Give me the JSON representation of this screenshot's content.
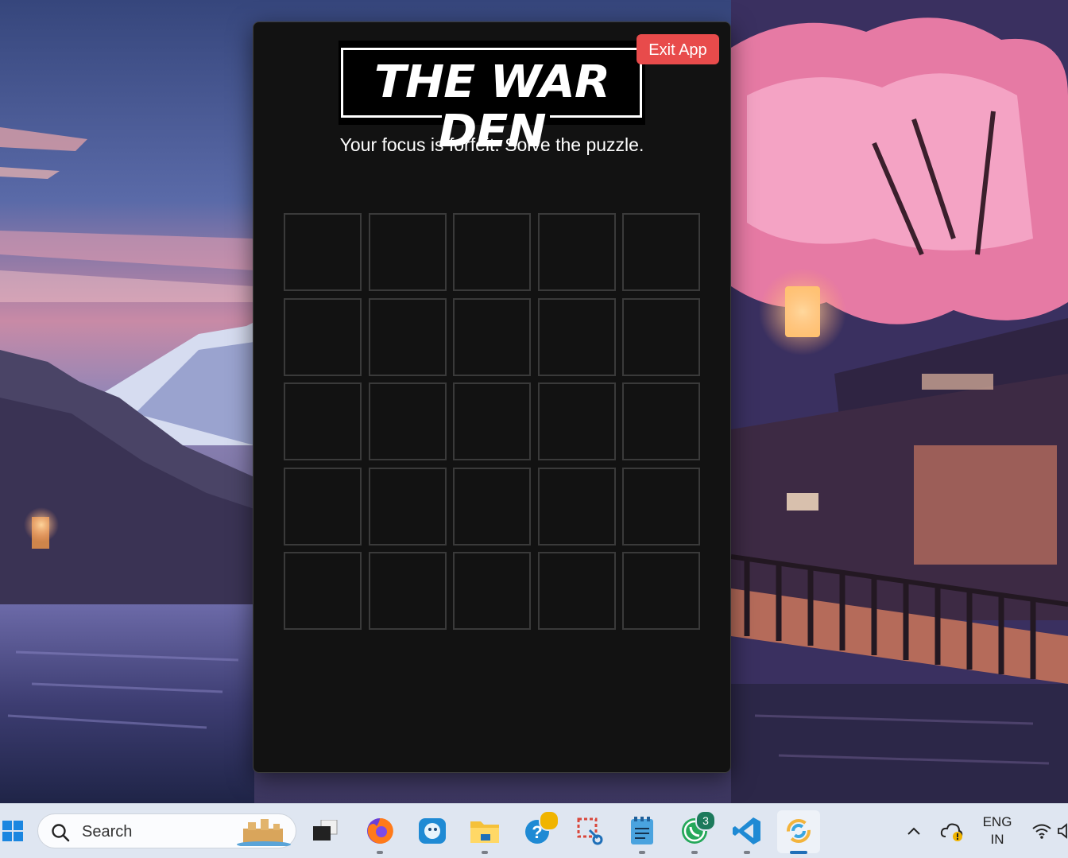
{
  "app": {
    "logo_text": "THE WAR DEN",
    "exit_label": "Exit App",
    "subtitle": "Your focus is forfeit. Solve the puzzle.",
    "grid": {
      "rows": 5,
      "columns": 5
    }
  },
  "taskbar": {
    "search_placeholder": "Search",
    "whatsapp_badge": "3",
    "language_line1": "ENG",
    "language_line2": "IN",
    "icons": [
      "windows-start-icon",
      "search-icon",
      "task-view-icon",
      "firefox-icon",
      "blue-app-icon",
      "file-explorer-icon",
      "help-icon",
      "snipping-tool-icon",
      "notepad-icon",
      "whatsapp-icon",
      "vscode-icon",
      "active-app-icon",
      "chevron-up-icon",
      "cloud-warning-icon",
      "wifi-icon",
      "volume-icon"
    ]
  },
  "colors": {
    "window_bg": "#121212",
    "cell_border": "#3a3a3a",
    "exit_button": "#e84b4b",
    "taskbar_bg": "#dfe6f1"
  }
}
